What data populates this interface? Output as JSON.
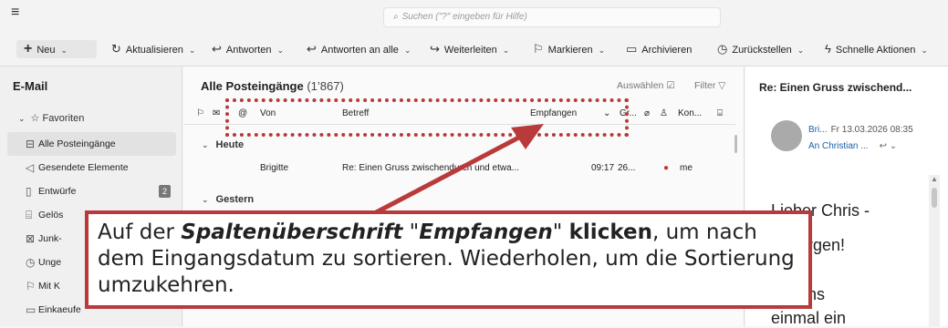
{
  "search": {
    "placeholder": "Suchen (\"?\" eingeben für Hilfe)"
  },
  "toolbar": {
    "new_label": "Neu",
    "refresh_label": "Aktualisieren",
    "reply_label": "Antworten",
    "reply_all_label": "Antworten an alle",
    "forward_label": "Weiterleiten",
    "flag_label": "Markieren",
    "archive_label": "Archivieren",
    "snooze_label": "Zurückstellen",
    "quick_actions_label": "Schnelle Aktionen"
  },
  "sidebar": {
    "title": "E-Mail",
    "favorites_label": "Favoriten",
    "items": [
      {
        "label": "Alle Posteingänge",
        "icon": "inbox-icon"
      },
      {
        "label": "Gesendete Elemente",
        "icon": "send-icon"
      },
      {
        "label": "Entwürfe",
        "icon": "draft-icon",
        "badge": "2"
      },
      {
        "label": "Gelös",
        "icon": "trash-icon"
      },
      {
        "label": "Junk-",
        "icon": "junk-icon"
      },
      {
        "label": "Unge",
        "icon": "clock-icon"
      },
      {
        "label": "Mit K",
        "icon": "flag-icon"
      },
      {
        "label": "Einkaeufe",
        "icon": "folder-icon"
      }
    ]
  },
  "list": {
    "title": "Alle Posteingänge",
    "count": "(1’867)",
    "select_label": "Auswählen",
    "filter_label": "Filter",
    "columns": {
      "from": "Von",
      "subject": "Betreff",
      "received": "Empfangen",
      "size": "Gr...",
      "contacts": "Kon..."
    },
    "groups": {
      "today": "Heute",
      "yesterday": "Gestern"
    },
    "rows": [
      {
        "from": "Brigitte",
        "subject": "Re: Einen Gruss zwischendurch und etwa...",
        "time": "09:17",
        "size": "26...",
        "to": "me"
      }
    ]
  },
  "reading": {
    "subject": "Re: Einen Gruss zwischend...",
    "sender": "Bri...",
    "date": "Fr 13.03.2026 08:35",
    "to": "An Christian ...",
    "body_lines": [
      "Lieber Chris -",
      "n Morgen!",
      "erstens",
      "einmal ein"
    ]
  },
  "callout": {
    "t1": "Auf der ",
    "t2": "Spaltenüberschrift",
    "t3": " \"",
    "t4": "Empfangen",
    "t5": "\" ",
    "t6": "klicken",
    "t7": ", um nach dem Eingangsdatum zu sortieren. Wiederholen, um die Sortierung umzukehren."
  },
  "colors": {
    "annotation": "#b83a3a",
    "link": "#1b5fa8",
    "selected": "#e2e2e2"
  }
}
